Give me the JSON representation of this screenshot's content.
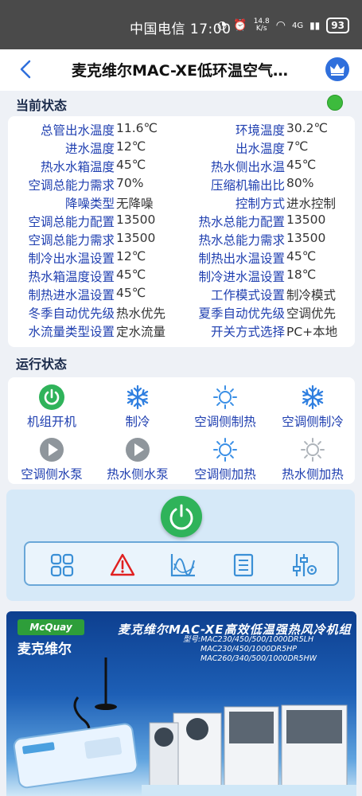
{
  "status_bar": {
    "carrier_time": "中国电信 17:00",
    "speed_value": "14.8",
    "speed_unit": "K/s",
    "network": "4G",
    "battery": "93"
  },
  "header": {
    "title": "麦克维尔MAC-XE低环温空气…"
  },
  "current_status": {
    "title": "当前状态",
    "online_color": "#3dbb3d",
    "rows": [
      {
        "l_label": "总管出水温度",
        "l_value": "11.6℃",
        "r_label": "环境温度",
        "r_value": "30.2℃"
      },
      {
        "l_label": "进水温度",
        "l_value": "12℃",
        "r_label": "出水温度",
        "r_value": "7℃"
      },
      {
        "l_label": "热水水箱温度",
        "l_value": "45℃",
        "r_label": "热水侧出水温",
        "r_value": "45℃"
      },
      {
        "l_label": "空调总能力需求",
        "l_value": "70%",
        "r_label": "压缩机输出比",
        "r_value": "80%"
      },
      {
        "l_label": "降噪类型",
        "l_value": "无降噪",
        "r_label": "控制方式",
        "r_value": "进水控制"
      },
      {
        "l_label": "空调总能力配置",
        "l_value": "13500",
        "r_label": "热水总能力配置",
        "r_value": "13500"
      },
      {
        "l_label": "空调总能力需求",
        "l_value": "13500",
        "r_label": "热水总能力需求",
        "r_value": "13500"
      },
      {
        "l_label": "制冷出水温设置",
        "l_value": "12℃",
        "r_label": "制热出水温设置",
        "r_value": "45℃"
      },
      {
        "l_label": "热水箱温度设置",
        "l_value": "45℃",
        "r_label": "制冷进水温设置",
        "r_value": "18℃"
      },
      {
        "l_label": "制热进水温设置",
        "l_value": "45℃",
        "r_label": "工作模式设置",
        "r_value": "制冷模式"
      },
      {
        "l_label": "冬季自动优先级",
        "l_value": "热水优先",
        "r_label": "夏季自动优先级",
        "r_value": "空调优先"
      },
      {
        "l_label": "水流量类型设置",
        "l_value": "定水流量",
        "r_label": "开关方式选择",
        "r_value": "PC+本地"
      }
    ]
  },
  "run_status": {
    "title": "运行状态",
    "items": [
      {
        "label": "机组开机",
        "icon": "power-on-icon"
      },
      {
        "label": "制冷",
        "icon": "snowflake-icon"
      },
      {
        "label": "空调侧制热",
        "icon": "sun-icon"
      },
      {
        "label": "空调侧制冷",
        "icon": "snowflake-icon"
      },
      {
        "label": "空调侧水泵",
        "icon": "pump-play-icon"
      },
      {
        "label": "热水侧水泵",
        "icon": "pump-play-icon"
      },
      {
        "label": "空调侧加热",
        "icon": "sun-icon"
      },
      {
        "label": "热水侧加热",
        "icon": "sun-inactive-icon"
      }
    ]
  },
  "toolbar": {
    "items": [
      "grid-icon",
      "alarm-warning-icon",
      "trend-chart-icon",
      "document-list-icon",
      "settings-sliders-icon"
    ]
  },
  "banner": {
    "logo_text": "McQuay",
    "brand_cn": "麦克维尔",
    "title": "麦克维尔MAC-XE高效低温强热风冷机组",
    "models": [
      "型号:MAC230/450/500/1000DR5LH",
      "MAC230/450/1000DR5HP",
      "MAC260/340/500/1000DR5HW"
    ]
  }
}
